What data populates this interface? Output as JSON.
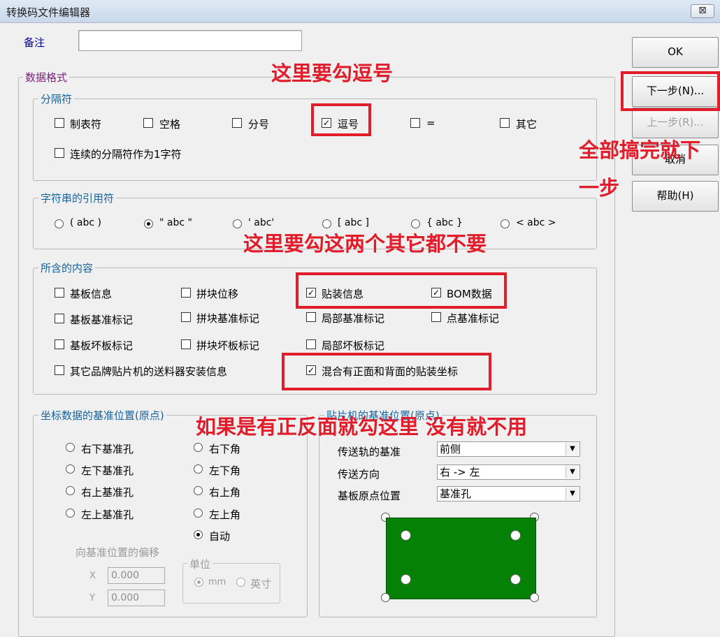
{
  "window": {
    "title": "转换码文件编辑器",
    "close_symbol": "⊠"
  },
  "note": {
    "label": "备注",
    "value": ""
  },
  "data_format": {
    "title": "数据格式",
    "separator": {
      "title": "分隔符",
      "options": [
        {
          "label": "制表符",
          "checked": false
        },
        {
          "label": "空格",
          "checked": false
        },
        {
          "label": "分号",
          "checked": false
        },
        {
          "label": "逗号",
          "checked": true
        },
        {
          "label": "=",
          "checked": false
        },
        {
          "label": "其它",
          "checked": false
        }
      ],
      "continuous": {
        "label": "连续的分隔符作为1字符",
        "checked": false
      }
    },
    "quote": {
      "title": "字符串的引用符",
      "options": [
        {
          "label": "( abc )",
          "selected": false
        },
        {
          "label": "\" abc \"",
          "selected": true
        },
        {
          "label": "' abc'",
          "selected": false
        },
        {
          "label": "[ abc ]",
          "selected": false
        },
        {
          "label": "{ abc }",
          "selected": false
        },
        {
          "label": "< abc >",
          "selected": false
        }
      ]
    },
    "contents": {
      "title": "所含的内容",
      "options": [
        {
          "label": "基板信息",
          "checked": false
        },
        {
          "label": "拼块位移",
          "checked": false
        },
        {
          "label": "贴装信息",
          "checked": true
        },
        {
          "label": "BOM数据",
          "checked": true
        },
        {
          "label": "基板基准标记",
          "checked": false
        },
        {
          "label": "拼块基准标记",
          "checked": false
        },
        {
          "label": "局部基准标记",
          "checked": false
        },
        {
          "label": "点基准标记",
          "checked": false
        },
        {
          "label": "基板坏板标记",
          "checked": false
        },
        {
          "label": "拼块坏板标记",
          "checked": false
        },
        {
          "label": "局部坏板标记",
          "checked": false
        },
        {
          "label": "其它品牌贴片机的送料器安装信息",
          "checked": false
        },
        {
          "label": "混合有正面和背面的贴装坐标",
          "checked": true
        }
      ]
    },
    "origin": {
      "title": "坐标数据的基准位置(原点)",
      "options": [
        {
          "label": "右下基准孔",
          "selected": false
        },
        {
          "label": "右下角",
          "selected": false
        },
        {
          "label": "左下基准孔",
          "selected": false
        },
        {
          "label": "左下角",
          "selected": false
        },
        {
          "label": "右上基准孔",
          "selected": false
        },
        {
          "label": "右上角",
          "selected": false
        },
        {
          "label": "左上基准孔",
          "selected": false
        },
        {
          "label": "左上角",
          "selected": false
        },
        {
          "label": "自动",
          "selected": true
        }
      ],
      "offset_title": "向基准位置的偏移",
      "x_label": "X",
      "x_value": "0.000",
      "y_label": "Y",
      "y_value": "0.000",
      "unit_title": "单位",
      "unit_mm": "mm",
      "unit_inch": "英寸",
      "unit_selected": "mm"
    },
    "machine_origin": {
      "title": "贴片机的基准位置(原点)",
      "conveyor_ref_label": "传送轨的基准",
      "conveyor_ref_value": "前侧",
      "direction_label": "传送方向",
      "direction_value": "右 -> 左",
      "board_origin_label": "基板原点位置",
      "board_origin_value": "基准孔",
      "board_color": "#058205"
    }
  },
  "buttons": {
    "ok": "OK",
    "next": "下一步(N)...",
    "prev": "上一步(R)...",
    "cancel": "取消",
    "help": "帮助(H)"
  },
  "annotations": {
    "comma": "这里要勾逗号",
    "next_step_line1": "全部搞完就下",
    "next_step_line2": "一步",
    "contents": "这里要勾这两个其它都不要",
    "mixed": "如果是有正反面就勾这里 没有就不用",
    "color": "#e11d2b"
  }
}
